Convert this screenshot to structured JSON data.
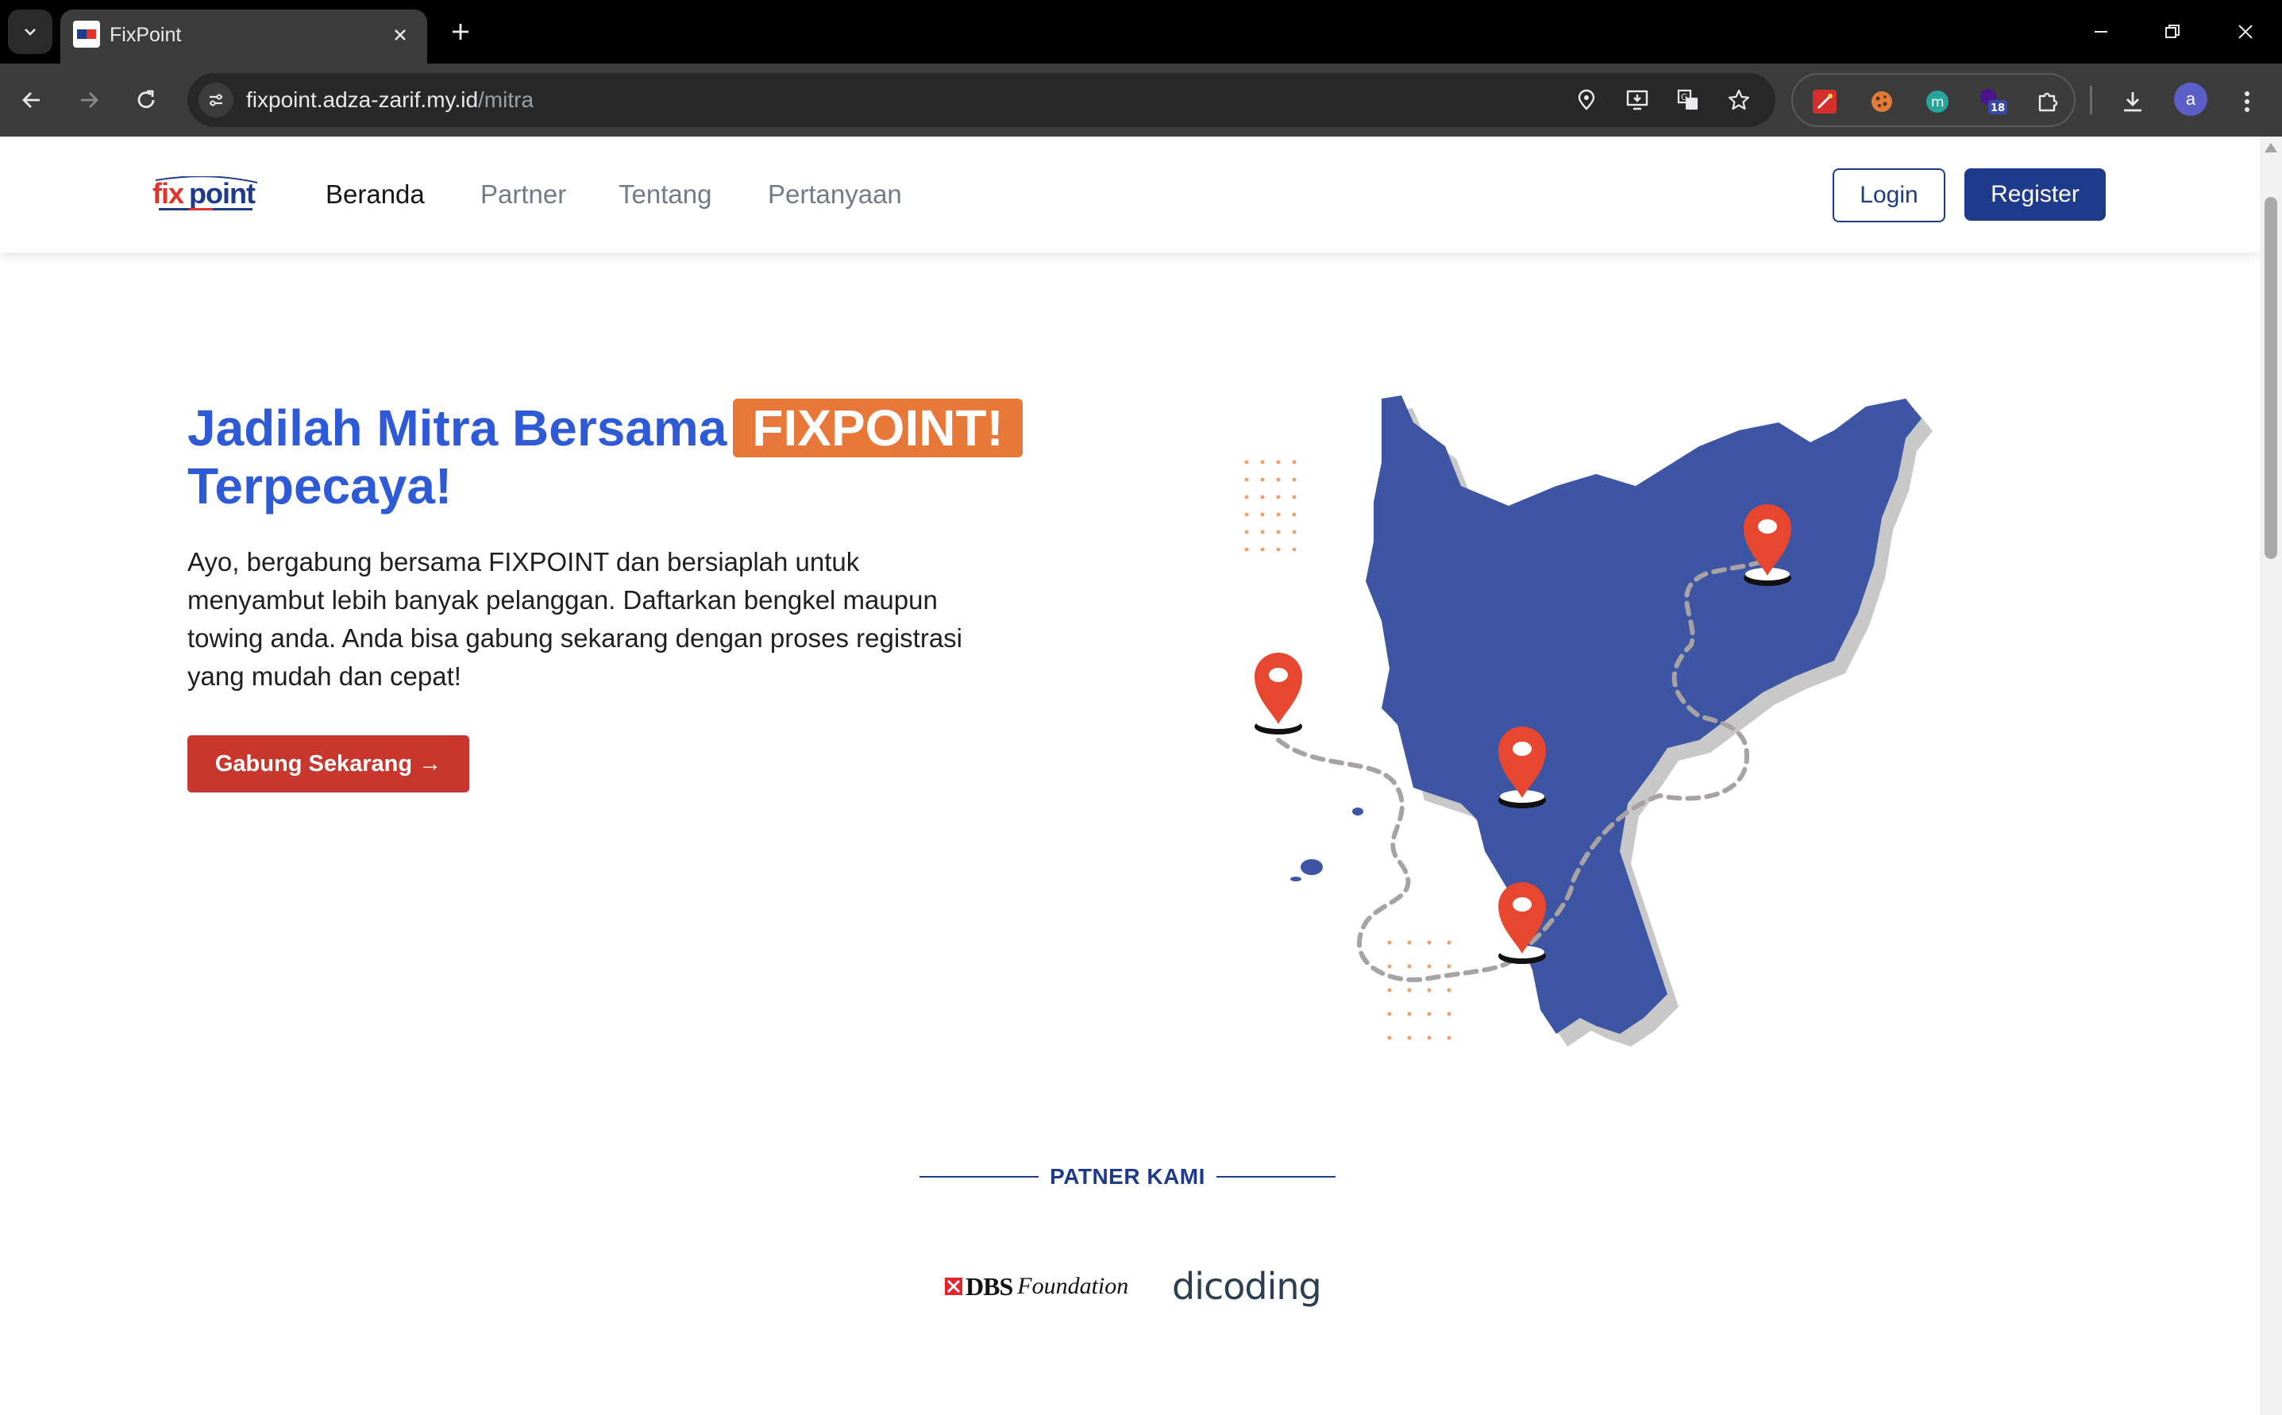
{
  "browser": {
    "tab_title": "FixPoint",
    "url_host": "fixpoint.adza-zarif.my.id",
    "url_path": "/mitra",
    "extension_badge": "18",
    "profile_initial": "a"
  },
  "nav": {
    "items": [
      "Beranda",
      "Partner",
      "Tentang",
      "Pertanyaan"
    ],
    "login_label": "Login",
    "register_label": "Register"
  },
  "hero": {
    "title_line1": "Jadilah Mitra Bersama",
    "title_highlight": "FIXPOINT!",
    "title_line2": "Terpecaya!",
    "description": "Ayo, bergabung bersama FIXPOINT dan bersiaplah untuk menyambut lebih banyak pelanggan. Daftarkan bengkel maupun towing anda. Anda bisa gabung sekarang dengan proses registrasi yang mudah dan cepat!",
    "cta_label": "Gabung Sekarang →"
  },
  "partners": {
    "heading": "PATNER KAMI",
    "logos": [
      "DBS",
      "Foundation",
      "dicoding"
    ]
  },
  "colors": {
    "brand_blue": "#1e3a8a",
    "title_blue": "#2f5ad6",
    "highlight_orange": "#e8783a",
    "cta_red": "#c8372d",
    "map_blue": "#3e55a3",
    "pin_red": "#e8472f"
  },
  "icons": {
    "map": "map-illustration-icon",
    "pin": "location-pin-icon"
  }
}
